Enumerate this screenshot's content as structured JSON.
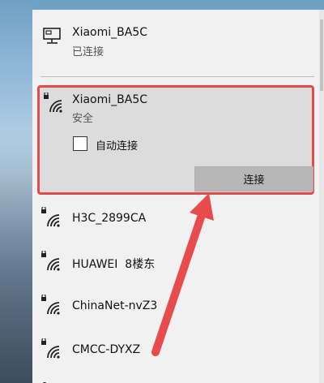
{
  "connected_network": {
    "name": "Xiaomi_BA5C",
    "status": "已连接"
  },
  "selected_network": {
    "name": "Xiaomi_BA5C",
    "security": "安全",
    "auto_connect_label": "自动连接",
    "auto_connect_checked": false,
    "connect_label": "连接"
  },
  "networks": [
    {
      "name": "H3C_2899CA"
    },
    {
      "name": "HUAWEI  8楼东"
    },
    {
      "name": "ChinaNet-nvZ3"
    },
    {
      "name": "CMCC-DYXZ"
    }
  ],
  "colors": {
    "highlight_border": "#e34a4a",
    "annotation_arrow": "#e84b4b",
    "panel_bg": "#f1f1f1",
    "selected_bg": "#dcdcdc"
  },
  "icons": {
    "connected": "ethernet-monitor-icon",
    "wifi": "wifi-secured-icon"
  }
}
